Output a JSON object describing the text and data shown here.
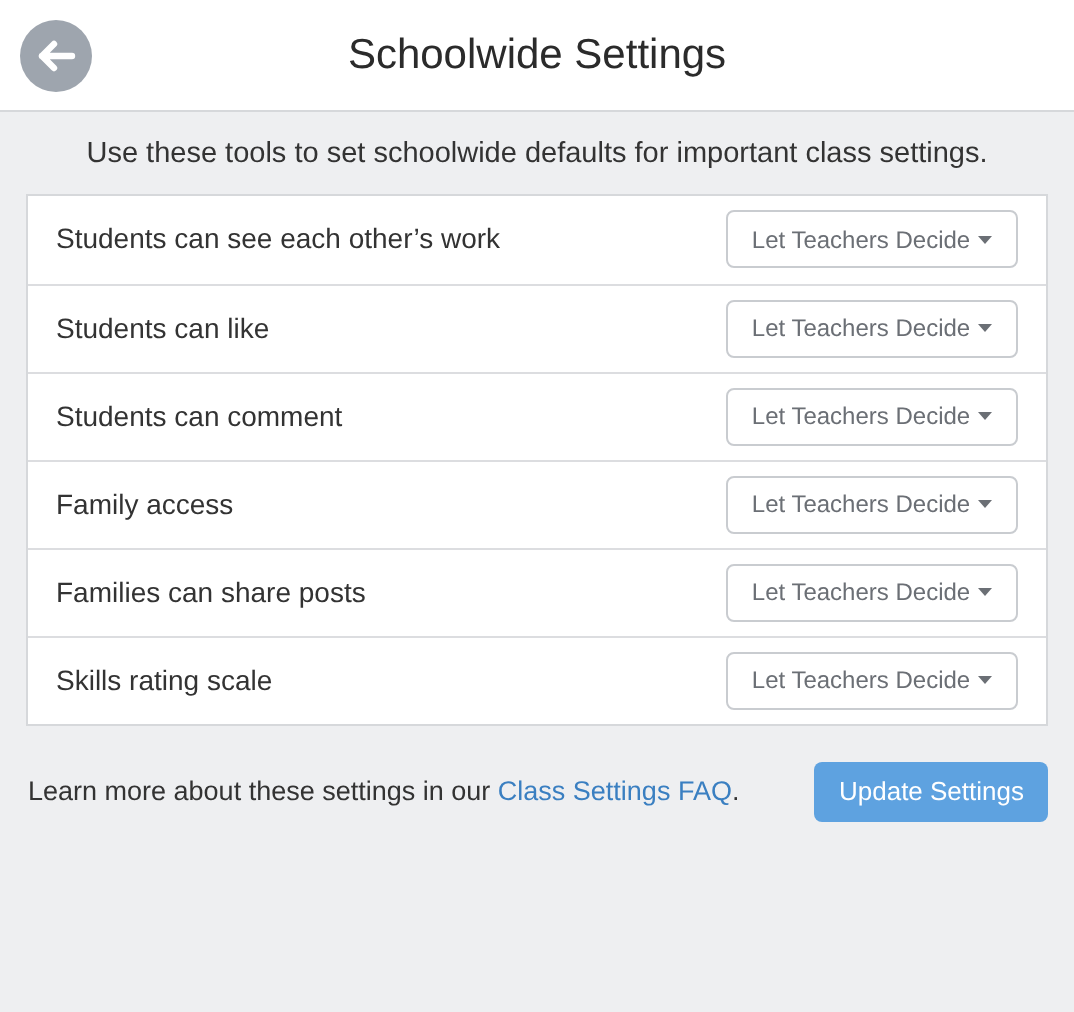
{
  "header": {
    "title": "Schoolwide Settings"
  },
  "intro": "Use these tools to set schoolwide defaults for important class settings.",
  "settings": [
    {
      "label": "Students can see each other’s work",
      "value": "Let Teachers Decide"
    },
    {
      "label": "Students can like",
      "value": "Let Teachers Decide"
    },
    {
      "label": "Students can comment",
      "value": "Let Teachers Decide"
    },
    {
      "label": "Family access",
      "value": "Let Teachers Decide"
    },
    {
      "label": "Families can share posts",
      "value": "Let Teachers Decide"
    },
    {
      "label": "Skills rating scale",
      "value": "Let Teachers Decide"
    }
  ],
  "footer": {
    "text_before": "Learn more about these settings in our ",
    "link": "Class Settings FAQ",
    "text_after": ".",
    "button": "Update Settings"
  }
}
